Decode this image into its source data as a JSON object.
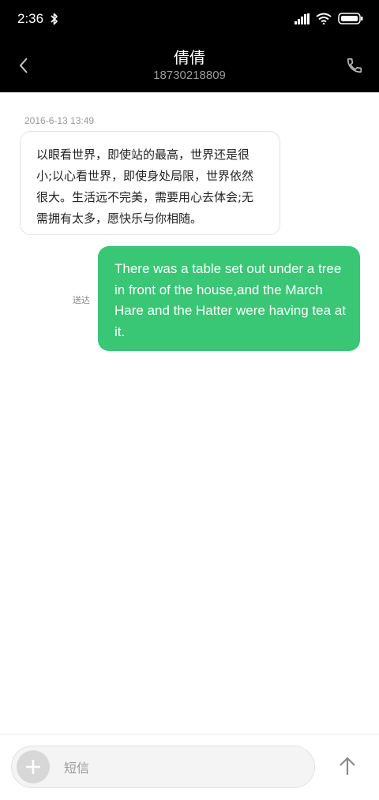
{
  "status_bar": {
    "time": "2:36"
  },
  "header": {
    "contact_name": "倩倩",
    "contact_number": "18730218809"
  },
  "conversation": {
    "timestamp": "2016-6-13 13:49",
    "incoming_message": "以眼看世界，即使站的最高，世界还是很小;以心看世界，即使身处局限，世界依然很大。生活远不完美，需要用心去体会;无需拥有太多，愿快乐与你相随。",
    "outgoing_message": "There was a table set out under a tree in front of the house,and the March Hare and the Hatter were having tea at it.",
    "delivery_status": "送达"
  },
  "composer": {
    "placeholder": "短信"
  },
  "colors": {
    "header_bg": "#000000",
    "outgoing_bubble": "#39c675",
    "incoming_bubble_border": "#e2e2e2"
  }
}
